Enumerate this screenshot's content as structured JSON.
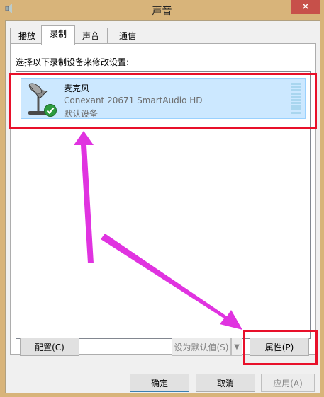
{
  "window": {
    "title": "声音",
    "close_symbol": "✕"
  },
  "tabs": [
    {
      "label": "播放"
    },
    {
      "label": "录制"
    },
    {
      "label": "声音"
    },
    {
      "label": "通信"
    }
  ],
  "active_tab": "录制",
  "instruction": "选择以下录制设备来修改设置:",
  "device": {
    "name": "麦克风",
    "description": "Conexant 20671 SmartAudio HD",
    "status": "默认设备",
    "icon": "microphone-icon",
    "status_icon": "green-check-icon"
  },
  "buttons": {
    "configure": "配置(C)",
    "set_default": "设为默认值(S)",
    "properties": "属性(P)",
    "ok": "确定",
    "cancel": "取消",
    "apply": "应用(A)"
  },
  "colors": {
    "titlebar": "#d8b47a",
    "selection": "#cce8ff",
    "highlight_box": "#e8102a",
    "arrow": "#e033e0"
  }
}
